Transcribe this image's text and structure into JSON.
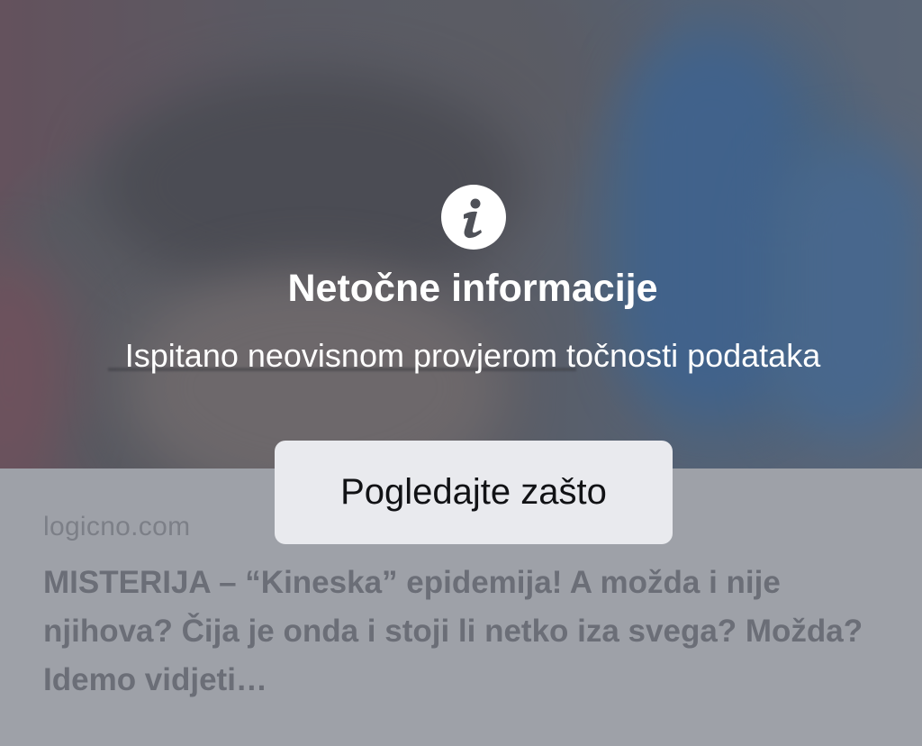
{
  "photo": {
    "description_icon": "blurred-photo"
  },
  "warning": {
    "icon": "info-icon",
    "title": "Netočne informacije",
    "subtitle": "Ispitano neovisnom provjerom točnosti podataka",
    "button_label": "Pogledajte zašto"
  },
  "link_preview": {
    "domain": "logicno.com",
    "headline": "MISTERIJA – “Kineska” epidemija! A možda i nije njihova? Čija je onda i stoji li netko iza svega? Možda? Idemo vidjeti…"
  },
  "colors": {
    "overlay": "#5a5c64",
    "button_bg": "#e9eaee",
    "button_text": "#111215",
    "headline": "#6b6e77",
    "domain": "#7c7f87"
  }
}
